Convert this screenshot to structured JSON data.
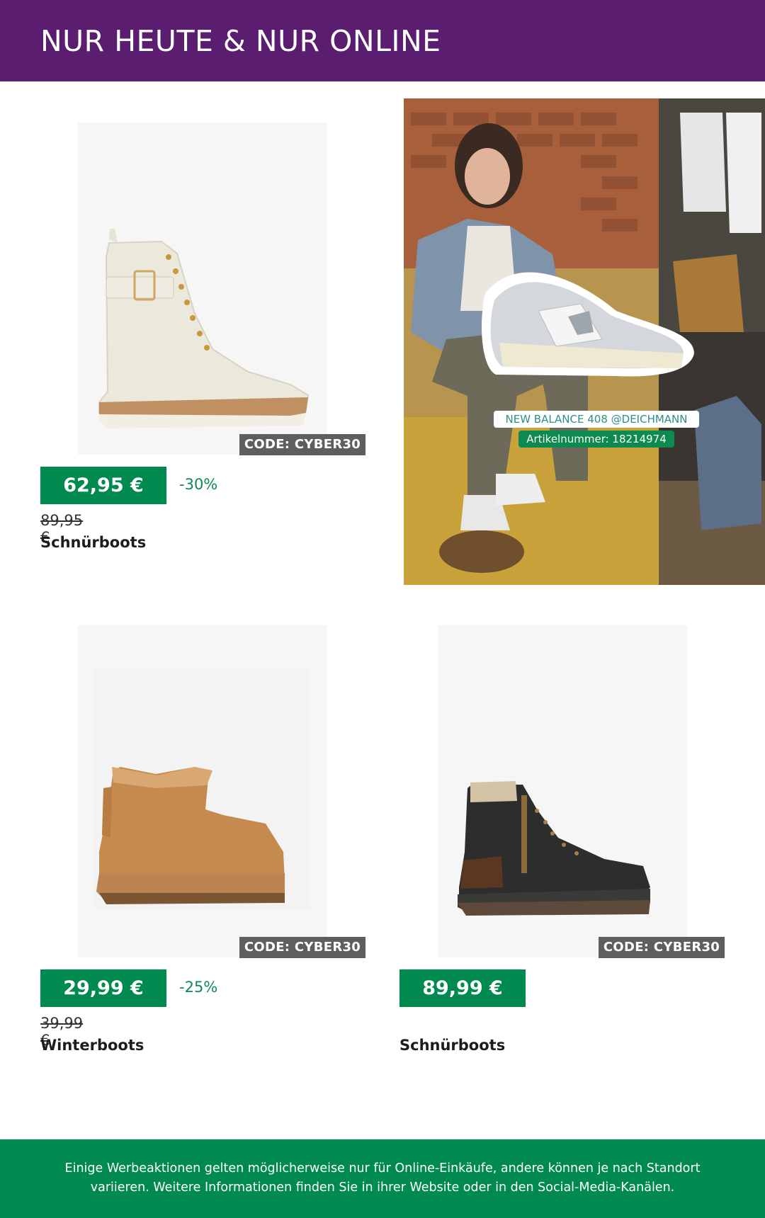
{
  "header": {
    "title": "NUR HEUTE & NUR ONLINE"
  },
  "products": [
    {
      "code": "CODE: CYBER30",
      "price": "62,95 €",
      "discount": "-30%",
      "old_price": "89,95 €",
      "name": "Schnürboots"
    },
    {
      "code": "CODE: CYBER30",
      "price": "29,99 €",
      "discount": "-25%",
      "old_price": "39,99 €",
      "name": "Winterboots"
    },
    {
      "code": "CODE: CYBER30",
      "price": "89,99 €",
      "name": "Schnürboots"
    }
  ],
  "promo": {
    "label": "NEW BALANCE 408 @DEICHMANN",
    "article": "Artikelnummer: 18214974"
  },
  "footer": {
    "text": "Einige Werbeaktionen gelten möglicherweise nur für Online-Einkäufe, andere können je nach Standort variieren. Weitere Informationen finden Sie in ihrer Website oder in den Social-Media-Kanälen."
  },
  "colors": {
    "header_bg": "#5a1d70",
    "price_green": "#008a4f",
    "code_badge": "#5e5e5e"
  }
}
